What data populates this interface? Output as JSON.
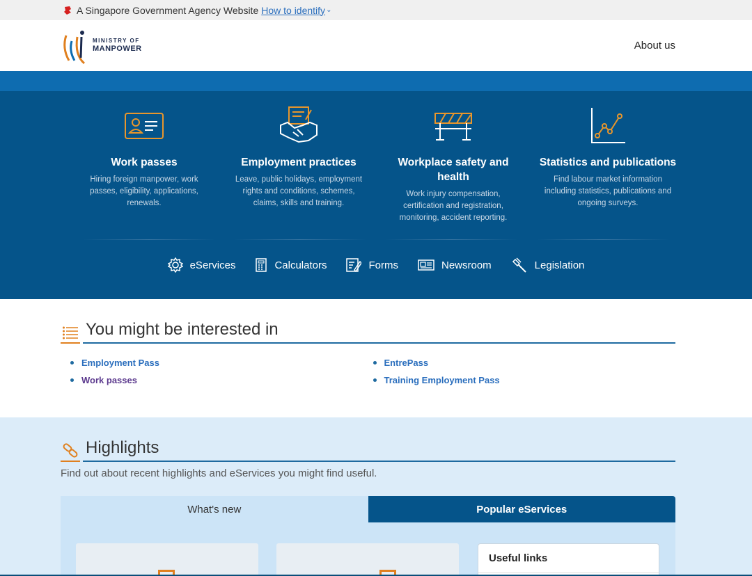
{
  "masthead": {
    "text": "A Singapore Government Agency Website",
    "link": "How to identify"
  },
  "header": {
    "logo_line1": "MINISTRY OF",
    "logo_line2": "MANPOWER",
    "about": "About us"
  },
  "categories": [
    {
      "title": "Work passes",
      "desc": "Hiring foreign manpower, work passes, eligibility, applications, renewals.",
      "icon": "id-card-icon"
    },
    {
      "title": "Employment practices",
      "desc": "Leave, public holidays, employment rights and conditions, schemes, claims, skills and training.",
      "icon": "handshake-icon"
    },
    {
      "title": "Workplace safety and health",
      "desc": "Work injury compensation, certification and registration, monitoring, accident reporting.",
      "icon": "barrier-icon"
    },
    {
      "title": "Statistics and publications",
      "desc": "Find labour market information including statistics, publications and ongoing surveys.",
      "icon": "line-chart-icon"
    }
  ],
  "quick_links": [
    {
      "label": "eServices",
      "icon": "gear-icon"
    },
    {
      "label": "Calculators",
      "icon": "calculator-icon"
    },
    {
      "label": "Forms",
      "icon": "form-icon"
    },
    {
      "label": "Newsroom",
      "icon": "newspaper-icon"
    },
    {
      "label": "Legislation",
      "icon": "gavel-icon"
    }
  ],
  "interest": {
    "title": "You might be interested in",
    "links": [
      "Employment Pass",
      "EntrePass",
      "Work passes",
      "Training Employment Pass"
    ]
  },
  "highlights": {
    "title": "Highlights",
    "subtitle": "Find out about recent highlights and eServices you might find useful.",
    "tabs": [
      "What's new",
      "Popular eServices"
    ],
    "useful_links": "Useful links"
  },
  "colors": {
    "primary": "#05548a",
    "accent": "#e0801f",
    "band": "#0e6cb0",
    "link": "#2a6ebd"
  }
}
